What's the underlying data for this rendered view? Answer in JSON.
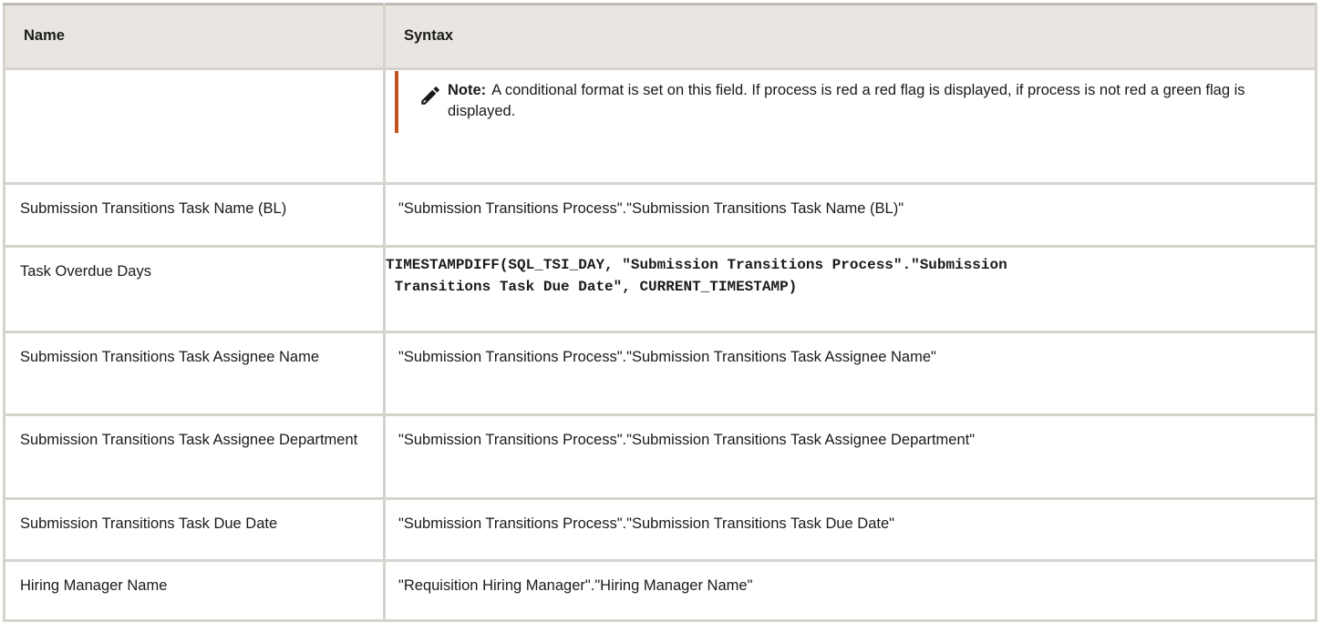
{
  "table": {
    "headers": {
      "name": "Name",
      "syntax": "Syntax"
    },
    "note": {
      "label": "Note:",
      "text": "A conditional format is set on this field. If process is red a red flag is displayed, if process is not red a green flag is displayed.",
      "icon": "pencil-icon",
      "accent_color": "#c4521c"
    },
    "rows": [
      {
        "name": "Submission Transitions Task Name (BL)",
        "syntax": "\"Submission Transitions Process\".\"Submission Transitions Task Name (BL)\""
      },
      {
        "name": "Task Overdue Days",
        "syntax": "TIMESTAMPDIFF(SQL_TSI_DAY, \"Submission Transitions Process\".\"Submission\n Transitions Task Due Date\", CURRENT_TIMESTAMP)"
      },
      {
        "name": "Submission Transitions Task Assignee Name",
        "syntax": "\"Submission Transitions Process\".\"Submission Transitions Task Assignee Name\""
      },
      {
        "name": "Submission Transitions Task Assignee Department",
        "syntax": "\"Submission Transitions Process\".\"Submission Transitions Task Assignee Department\""
      },
      {
        "name": "Submission Transitions Task Due Date",
        "syntax": "\"Submission Transitions Process\".\"Submission Transitions Task Due Date\""
      },
      {
        "name": "Hiring Manager Name",
        "syntax": "\"Requisition Hiring Manager\".\"Hiring Manager Name\""
      }
    ]
  }
}
